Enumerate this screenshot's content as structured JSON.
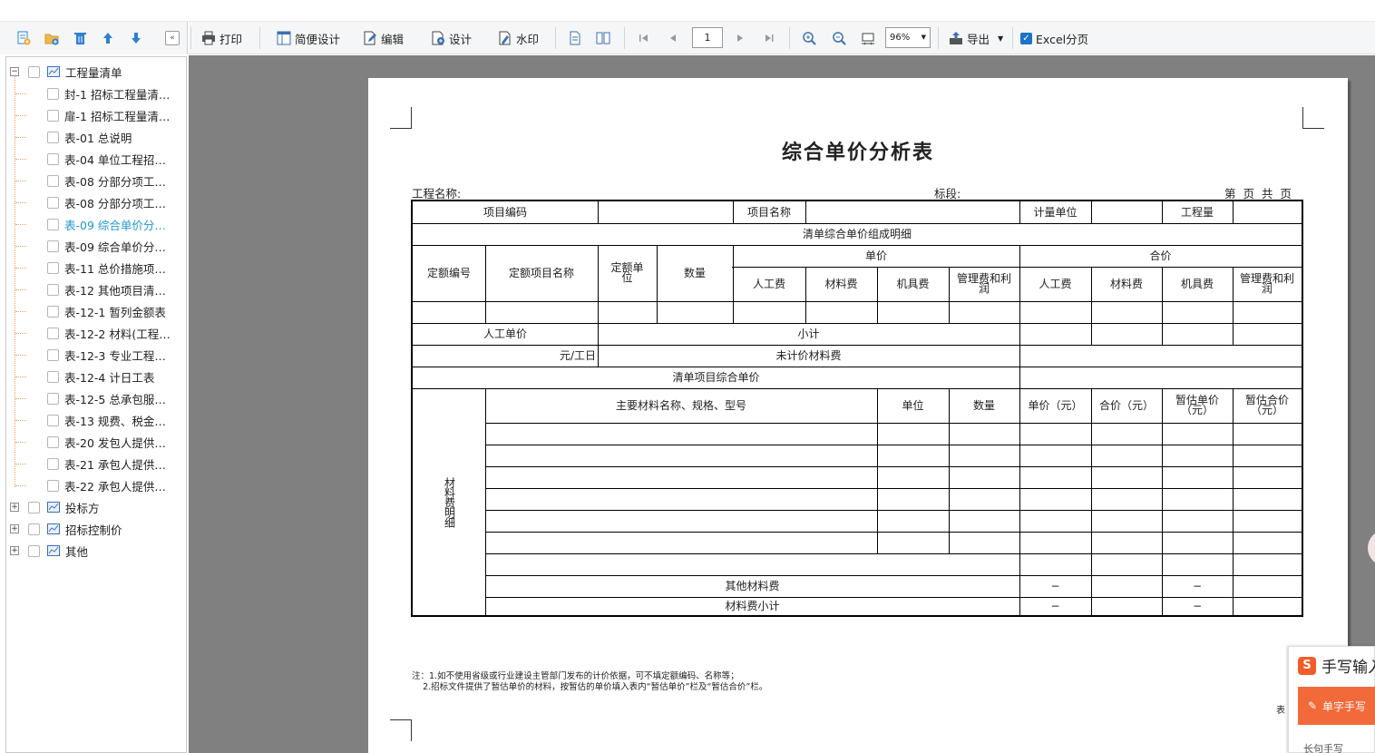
{
  "left_toolbar": {
    "icons": [
      "add-file-icon",
      "add-folder-icon",
      "delete-icon",
      "move-up-icon",
      "move-down-icon"
    ],
    "collapse": "«"
  },
  "tree": {
    "root": "工程量清单",
    "items": [
      "封-1 招标工程量清…",
      "扉-1 招标工程量清…",
      "表-01 总说明",
      "表-04 单位工程招…",
      "表-08 分部分项工…",
      "表-08 分部分项工…",
      "表-09 综合单价分…",
      "表-09 综合单价分…",
      "表-11 总价措施项…",
      "表-12 其他项目清…",
      "表-12-1 暂列金额表",
      "表-12-2 材料(工程…",
      "表-12-3 专业工程…",
      "表-12-4 计日工表",
      "表-12-5 总承包服…",
      "表-13 规费、税金…",
      "表-20 发包人提供…",
      "表-21 承包人提供…",
      "表-22 承包人提供…"
    ],
    "selected_index": 6,
    "others": [
      "投标方",
      "招标控制价",
      "其他"
    ],
    "expand_collapsed": "+",
    "expand_open": "−"
  },
  "toolbar": {
    "print": "打印",
    "simple_design": "简便设计",
    "edit": "编辑",
    "design": "设计",
    "watermark": "水印",
    "page": "1",
    "zoom": "96%",
    "export": "导出",
    "excel_paging": "Excel分页",
    "excel_checked": "✓"
  },
  "document": {
    "title": "综合单价分析表",
    "project_name_label": "工程名称:",
    "section_label": "标段:",
    "page_info": "第  页  共  页",
    "table": {
      "item_code": "项目编码",
      "item_name": "项目名称",
      "unit_of_measure": "计量单位",
      "quantity_of_work": "工程量",
      "composition_detail": "清单综合单价组成明细",
      "quota_code": "定额编号",
      "quota_name": "定额项目名称",
      "quota_unit": "定额单位",
      "quantity": "数量",
      "unit_price": "单价",
      "total_price": "合价",
      "labor": "人工费",
      "material": "材料费",
      "machinery": "机具费",
      "management": "管理费和利润",
      "labor_unit_price": "人工单价",
      "subtotal": "小计",
      "yuan_per_workday": "元/工日",
      "unpriced_material": "未计价材料费",
      "comprehensive_unit_price": "清单项目综合单价",
      "material_detail": "材料费明细",
      "main_material": "主要材料名称、规格、型号",
      "unit": "单位",
      "unit_price_yuan": "单价（元）",
      "total_price_yuan": "合价（元）",
      "est_unit_price": "暂估单价（元）",
      "est_total_price": "暂估合价（元）",
      "other_material": "其他材料费",
      "material_subtotal": "材料费小计",
      "dash": "−"
    },
    "note_line1": "注：1.如不使用省级或行业建设主管部门发布的计价依据，可不填定额编码、名称等；",
    "note_line2": "    2.招标文件提供了暂估单价的材料，按暂估的单价填入表内“暂估单价”栏及“暂估合价”栏。",
    "table_number": "表"
  },
  "ime": {
    "logo": "S",
    "title": "手写输入",
    "button": "单字手写",
    "footer": "长句手写"
  },
  "colors": {
    "selected_text": "#2196d3",
    "viewer_bg": "#808080",
    "ime_accent": "#f36a3a"
  }
}
